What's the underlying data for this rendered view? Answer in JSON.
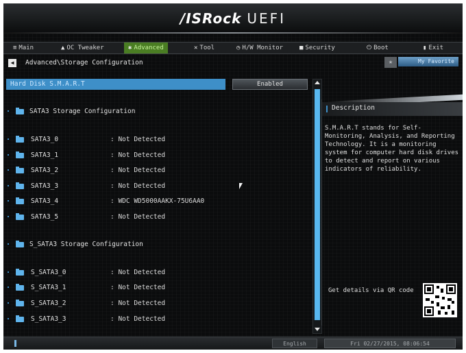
{
  "header": {
    "brand": "/ISRock",
    "product": "UEFI"
  },
  "tabs": [
    {
      "label": "Main",
      "icon": "list-icon"
    },
    {
      "label": "OC Tweaker",
      "icon": "rocket-icon"
    },
    {
      "label": "Advanced",
      "icon": "star-icon",
      "active": true
    },
    {
      "label": "Tool",
      "icon": "tools-icon"
    },
    {
      "label": "H/W Monitor",
      "icon": "monitor-icon"
    },
    {
      "label": "Security",
      "icon": "shield-icon"
    },
    {
      "label": "Boot",
      "icon": "power-icon"
    },
    {
      "label": "Exit",
      "icon": "exit-icon"
    }
  ],
  "breadcrumb": "Advanced\\Storage Configuration",
  "favorite": {
    "label": "My Favorite"
  },
  "smart": {
    "label": "Hard Disk S.M.A.R.T",
    "value": "Enabled"
  },
  "sections": [
    {
      "title": "SATA3 Storage Configuration",
      "ports": [
        {
          "name": "SATA3_0",
          "value": ": Not Detected"
        },
        {
          "name": "SATA3_1",
          "value": ": Not Detected"
        },
        {
          "name": "SATA3_2",
          "value": ": Not Detected"
        },
        {
          "name": "SATA3_3",
          "value": ": Not Detected"
        },
        {
          "name": "SATA3_4",
          "value": ": WDC WD5000AAKX-75U6AA0"
        },
        {
          "name": "SATA3_5",
          "value": ": Not Detected"
        }
      ]
    },
    {
      "title": "S_SATA3 Storage Configuration",
      "ports": [
        {
          "name": "S_SATA3_0",
          "value": ": Not Detected"
        },
        {
          "name": "S_SATA3_1",
          "value": ": Not Detected"
        },
        {
          "name": "S_SATA3_2",
          "value": ": Not Detected"
        },
        {
          "name": "S_SATA3_3",
          "value": ": Not Detected"
        }
      ]
    }
  ],
  "description": {
    "title": "Description",
    "text": "S.M.A.R.T stands for Self-Monitoring, Analysis, and Reporting Technology. It is a monitoring system for computer hard disk drives to detect and report on various indicators of reliability.",
    "qr_caption": "Get details via QR code"
  },
  "footer": {
    "language": "English",
    "datetime": "Fri 02/27/2015, 08:06:54"
  },
  "colors": {
    "accent": "#3e8fc8",
    "active_tab": "#4a7d23",
    "background": "#0b0c0d"
  }
}
